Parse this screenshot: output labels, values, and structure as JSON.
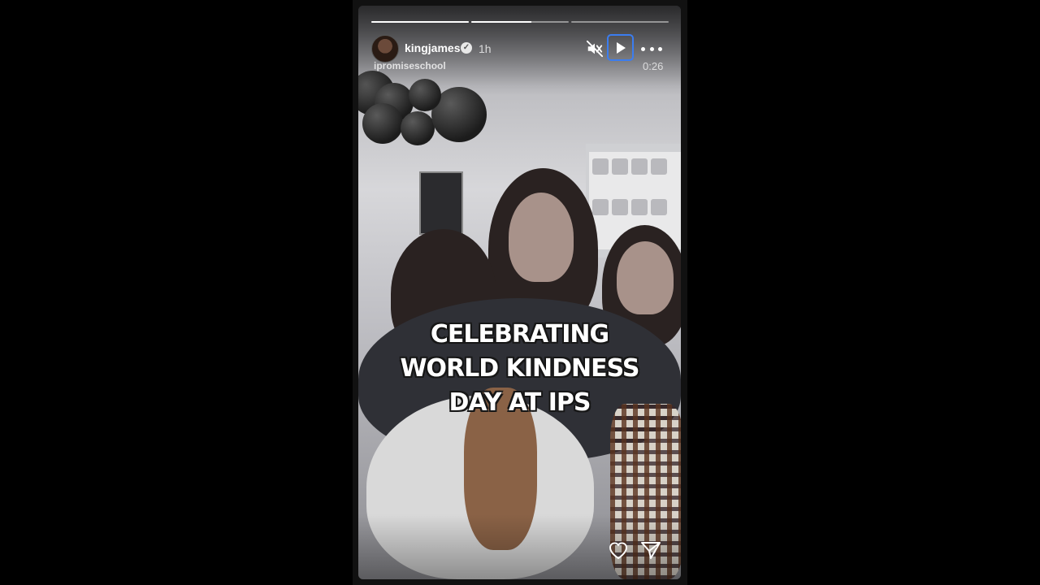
{
  "story": {
    "username": "kingjames",
    "verified_glyph": "✓",
    "time_ago": "1h",
    "sub_account": "ipromiseschool",
    "duration": "0:26",
    "progress_segments": [
      1,
      0.62,
      0
    ],
    "caption_lines": [
      "CELEBRATING",
      "WORLD KINDNESS",
      "DAY AT IPS"
    ]
  },
  "icons": {
    "mute": "speaker-muted-icon",
    "play": "play-icon",
    "more": "more-options-icon",
    "like": "heart-icon",
    "share": "send-icon"
  },
  "colors": {
    "background": "#000000",
    "focus_ring": "#3b7df0",
    "text": "#ffffff"
  }
}
